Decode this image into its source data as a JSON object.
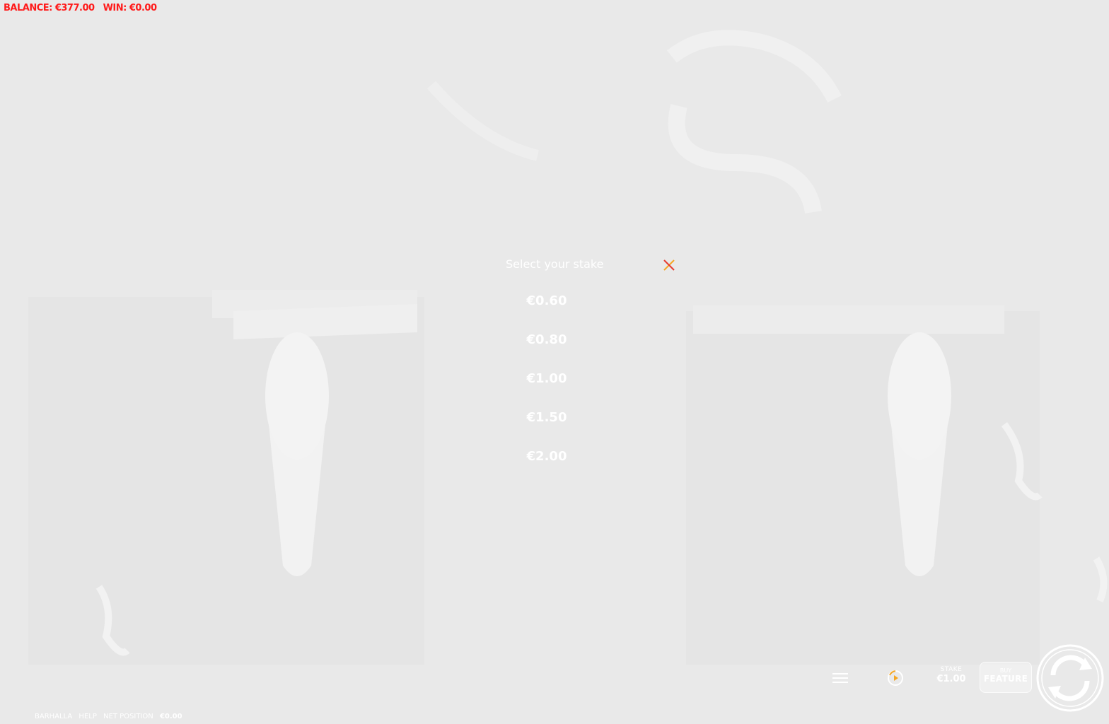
{
  "status": {
    "balance_text": "BALANCE: €377.00",
    "win_text": "WIN: €0.00"
  },
  "stake_selector": {
    "title": "Select your stake",
    "options": [
      "€0.60",
      "€0.80",
      "€1.00",
      "€1.50",
      "€2.00"
    ]
  },
  "bottom_info": {
    "game_name": "BARHALLA",
    "help_label": "HELP",
    "net_position_label": "NET POSITION",
    "net_position_value": "€0.00"
  },
  "controls": {
    "stake_label": "STAKE",
    "stake_value": "€1.00",
    "buy_label_top": "BUY",
    "buy_label_bottom": "FEATURE"
  },
  "colors": {
    "background": "#e9e9e9",
    "status_text": "#ff1a1a",
    "close_accent_orange": "#f5a623",
    "close_accent_red": "#e63a2e"
  },
  "icons": {
    "close": "close-icon",
    "menu": "menu-icon",
    "autoplay": "autoplay-icon",
    "spin": "spin-icon"
  }
}
